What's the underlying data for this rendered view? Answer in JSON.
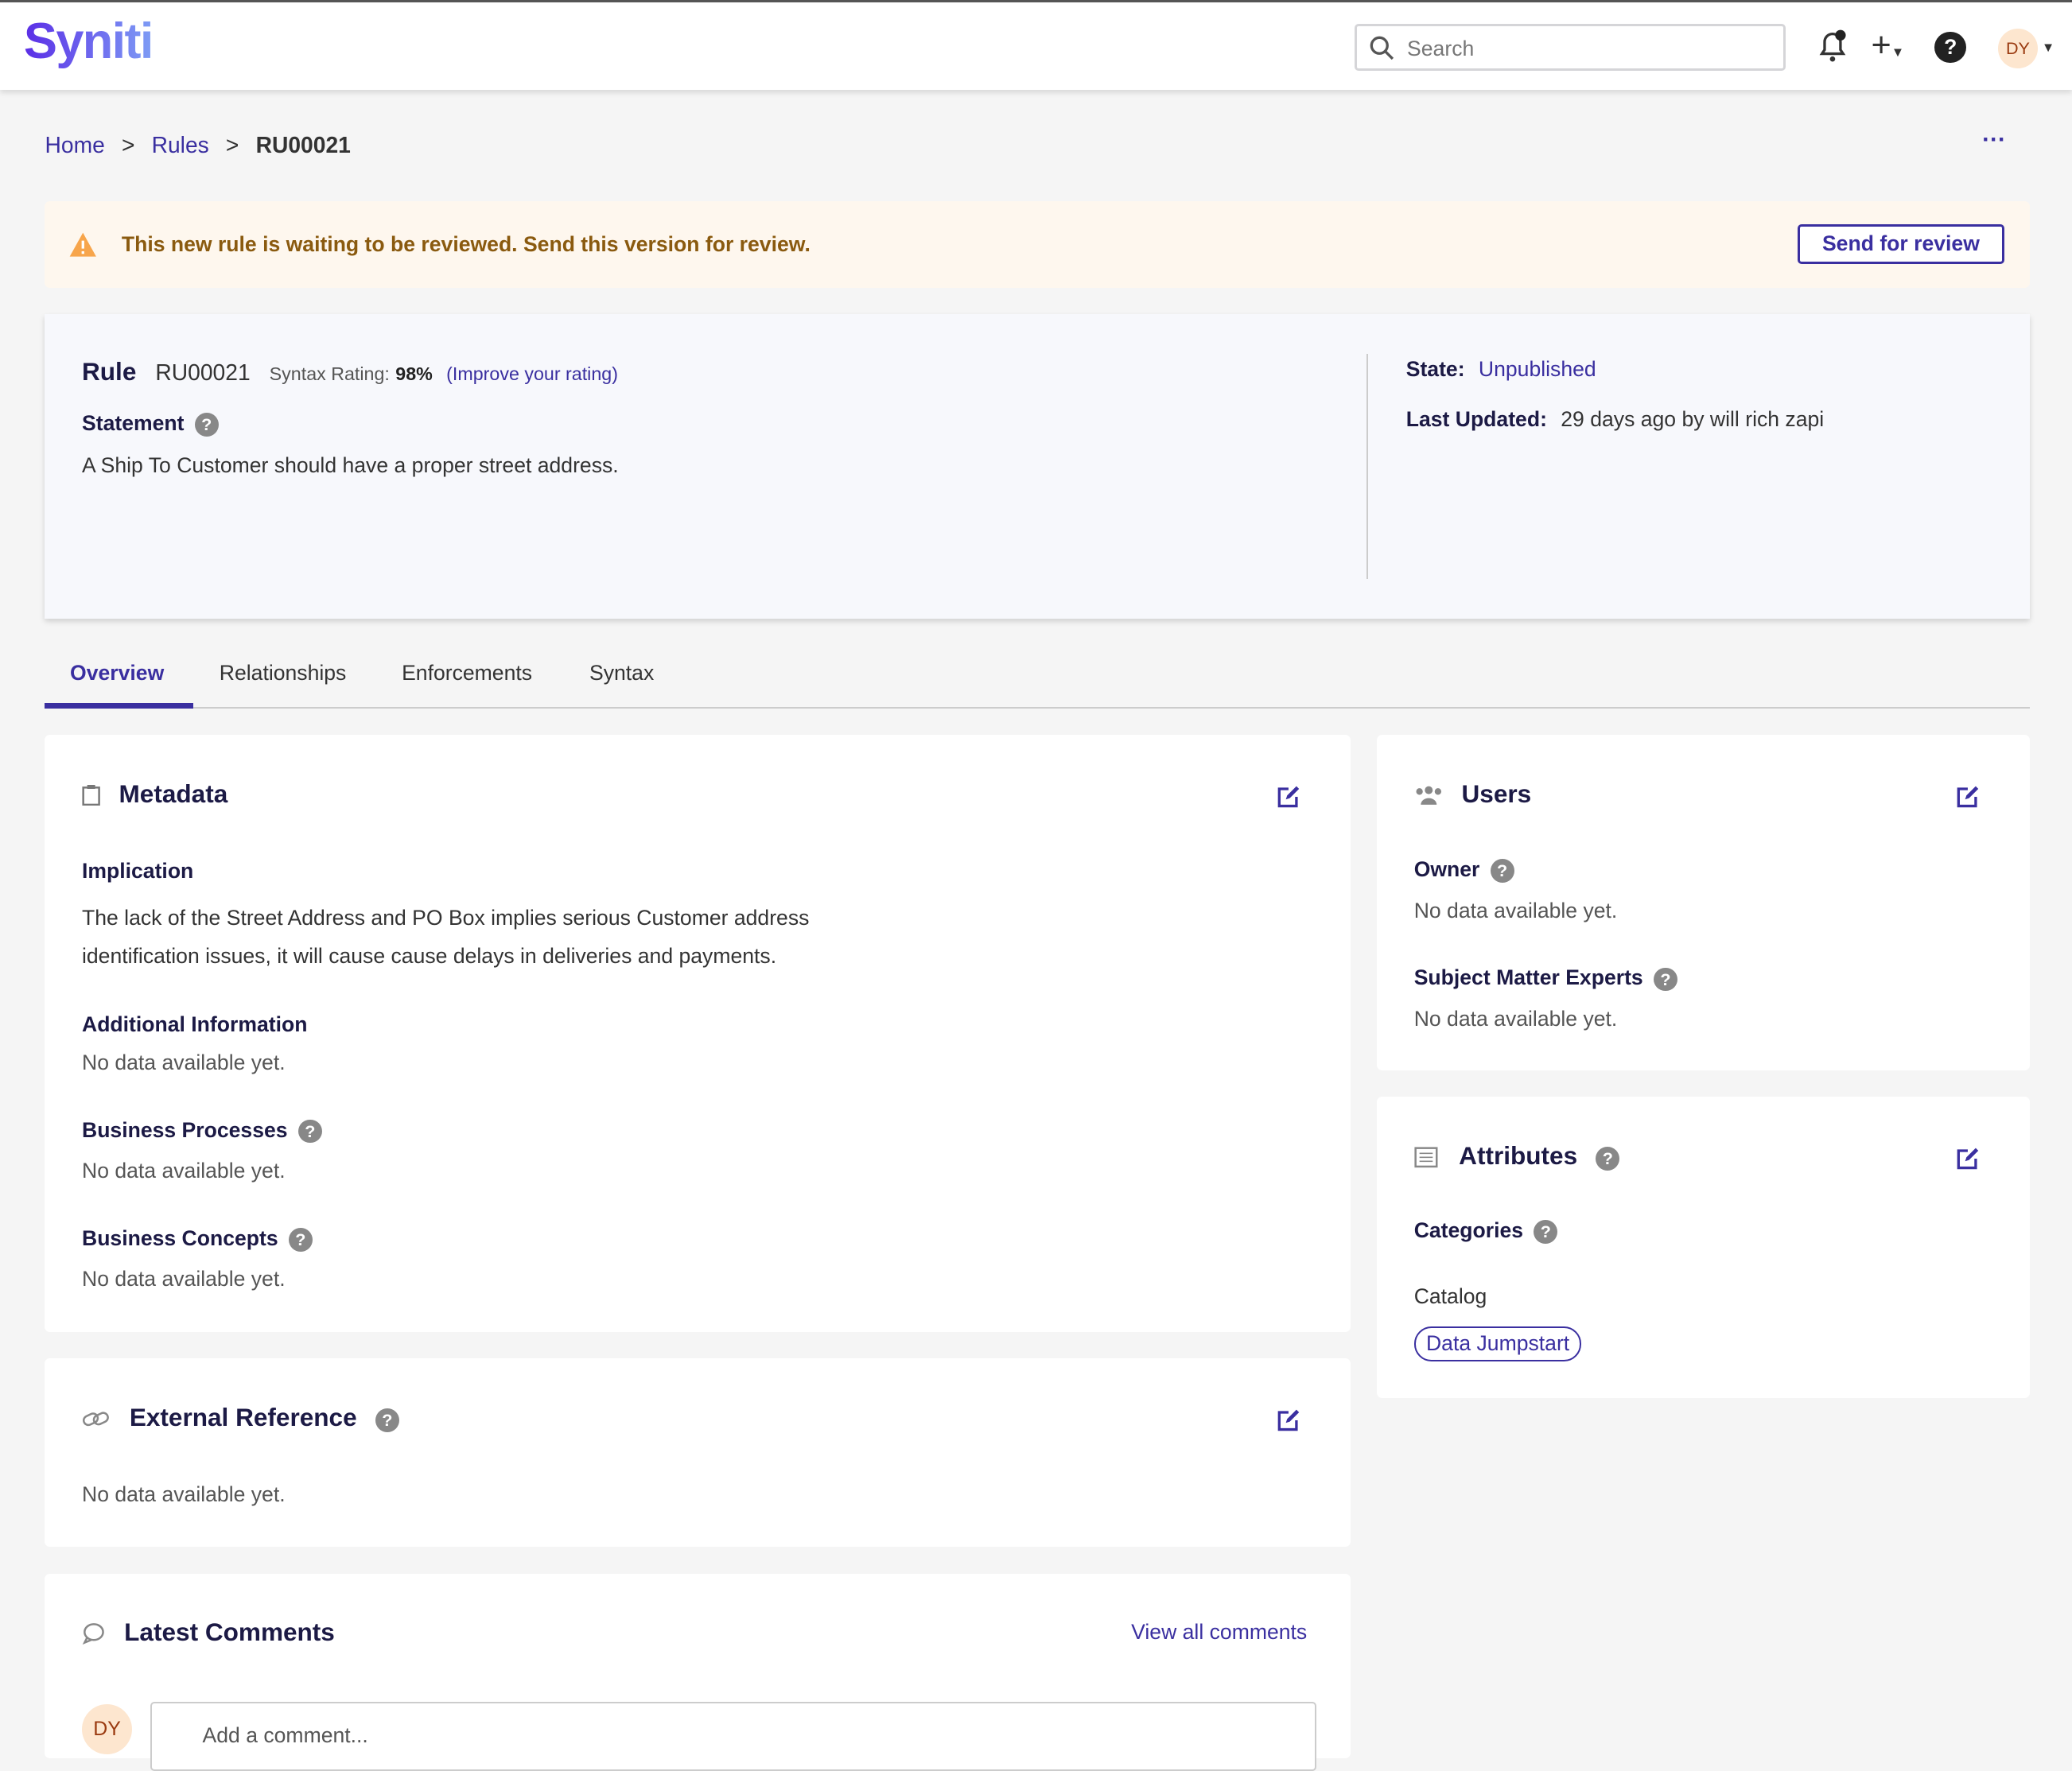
{
  "header": {
    "logo": "Syniti",
    "search_placeholder": "Search",
    "avatar": "DY"
  },
  "breadcrumb": {
    "home": "Home",
    "rules": "Rules",
    "current": "RU00021",
    "sep": ">"
  },
  "banner": {
    "message": "This new rule is waiting to be reviewed. Send this version for review.",
    "button": "Send for review"
  },
  "rule": {
    "label": "Rule",
    "id": "RU00021",
    "rating_label": "Syntax Rating:",
    "rating": "98%",
    "improve": "(Improve your rating)",
    "statement_label": "Statement",
    "statement": "A Ship To Customer should have a proper street address.",
    "state_label": "State:",
    "state": "Unpublished",
    "updated_label": "Last Updated:",
    "updated": "29 days ago by will rich zapi"
  },
  "tabs": [
    "Overview",
    "Relationships",
    "Enforcements",
    "Syntax"
  ],
  "metadata": {
    "title": "Metadata",
    "implication_label": "Implication",
    "implication": "The lack of the Street Address and PO Box implies serious Customer address identification issues, it will cause cause delays in deliveries and payments.",
    "additional_label": "Additional Information",
    "additional": "No data available yet.",
    "processes_label": "Business Processes",
    "processes": "No data available yet.",
    "concepts_label": "Business Concepts",
    "concepts": "No data available yet."
  },
  "users": {
    "title": "Users",
    "owner_label": "Owner",
    "owner": "No data available yet.",
    "sme_label": "Subject Matter Experts",
    "sme": "No data available yet."
  },
  "attributes": {
    "title": "Attributes",
    "categories_label": "Categories",
    "catalog_label": "Catalog",
    "catalog_tag": "Data Jumpstart"
  },
  "external": {
    "title": "External Reference",
    "value": "No data available yet."
  },
  "comments": {
    "title": "Latest Comments",
    "view_all": "View all comments",
    "avatar": "DY",
    "placeholder": "Add a comment..."
  }
}
